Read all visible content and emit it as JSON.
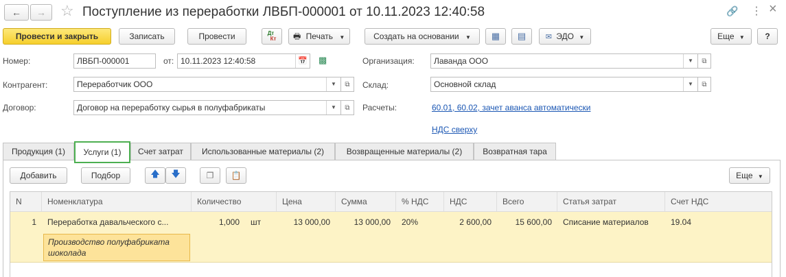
{
  "window": {
    "title": "Поступление из переработки ЛВБП-000001 от 10.11.2023 12:40:58",
    "more": "⋮",
    "close": "×"
  },
  "toolbar": {
    "post_close": "Провести и закрыть",
    "save": "Записать",
    "post": "Провести",
    "dtkt_top": "Дт",
    "dtkt_bottom": "Кт",
    "print": "Печать",
    "create_based": "Создать на основании",
    "edo": "ЭДО",
    "more": "Еще",
    "help": "?"
  },
  "form": {
    "number_label": "Номер:",
    "number_value": "ЛВБП-000001",
    "from_label": "от:",
    "date_value": "10.11.2023 12:40:58",
    "org_label": "Организация:",
    "org_value": "Лаванда ООО",
    "contractor_label": "Контрагент:",
    "contractor_value": "Переработчик ООО",
    "warehouse_label": "Склад:",
    "warehouse_value": "Основной склад",
    "contract_label": "Договор:",
    "contract_value": "Договор на переработку сырья в полуфабрикаты",
    "settlements_label": "Расчеты:",
    "settlements_link": "60.01, 60.02, зачет аванса автоматически",
    "vat_link": "НДС сверху"
  },
  "tabs": [
    {
      "label": "Продукция (1)"
    },
    {
      "label": "Услуги (1)"
    },
    {
      "label": "Счет затрат"
    },
    {
      "label": "Использованные материалы (2)"
    },
    {
      "label": "Возвращенные материалы (2)"
    },
    {
      "label": "Возвратная тара"
    }
  ],
  "table_toolbar": {
    "add": "Добавить",
    "pick": "Подбор",
    "more": "Еще"
  },
  "table": {
    "headers": [
      "N",
      "Номенклатура",
      "Количество",
      "Цена",
      "Сумма",
      "% НДС",
      "НДС",
      "Всего",
      "Статья затрат",
      "Счет НДС"
    ],
    "rows": [
      {
        "n": "1",
        "item": "Переработка давальческого с...",
        "qty": "1,000",
        "unit": "шт",
        "price": "13 000,00",
        "sum": "13 000,00",
        "vat_rate": "20%",
        "vat": "2 600,00",
        "total": "15 600,00",
        "cost_item": "Списание материалов",
        "vat_account": "19.04",
        "content": "Производство полуфабриката шоколада"
      }
    ]
  },
  "colors": {
    "primary_button": "#f6cf2c",
    "active_tab_border": "#4caf50",
    "selected_row": "#fdf3c6",
    "link": "#1a56b3"
  }
}
